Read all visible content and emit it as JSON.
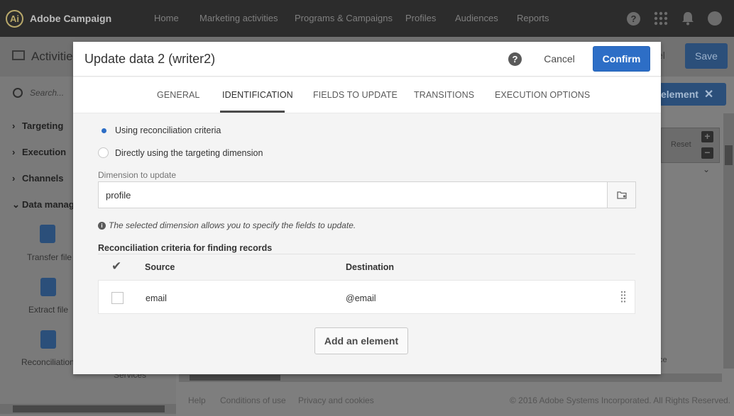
{
  "app": {
    "brand_logo": "Ai",
    "brand_name": "Adobe Campaign",
    "nav": [
      "Home",
      "Marketing activities",
      "Programs & Campaigns",
      "Profiles",
      "Audiences",
      "Reports"
    ],
    "icons": [
      "help-icon",
      "apps-grid-icon",
      "bell-icon",
      "avatar-icon"
    ]
  },
  "background": {
    "page_title": "Activities",
    "search_placeholder": "Search...",
    "categories": [
      "Targeting",
      "Execution",
      "Channels",
      "Data manag..."
    ],
    "tiles": [
      "Transfer file",
      "Extract file",
      "Reconciliation"
    ],
    "services_label": "Services",
    "cancel_fragment": "el",
    "save_label": "Save",
    "add_element_label": "element",
    "reset_label": "Reset",
    "ce_fragment": "ce",
    "footer": {
      "help": "Help",
      "conditions": "Conditions of use",
      "privacy": "Privacy and cookies",
      "copyright": "© 2016 Adobe Systems Incorporated. All Rights Reserved."
    }
  },
  "modal": {
    "title": "Update data 2 (writer2)",
    "help_icon": "?",
    "cancel_label": "Cancel",
    "confirm_label": "Confirm",
    "tabs": [
      {
        "label": "GENERAL",
        "active": false
      },
      {
        "label": "IDENTIFICATION",
        "active": true
      },
      {
        "label": "FIELDS TO UPDATE",
        "active": false
      },
      {
        "label": "TRANSITIONS",
        "active": false
      },
      {
        "label": "EXECUTION OPTIONS",
        "active": false
      }
    ],
    "radio_options": [
      {
        "label": "Using reconciliation criteria",
        "selected": true
      },
      {
        "label": "Directly using the targeting dimension",
        "selected": false
      }
    ],
    "dimension": {
      "label": "Dimension to update",
      "value": "profile"
    },
    "info_text": "The selected dimension allows you to specify the fields to update.",
    "criteria": {
      "title": "Reconciliation criteria for finding records",
      "columns": [
        "Source",
        "Destination"
      ],
      "rows": [
        {
          "source": "email",
          "destination": "@email",
          "checked": false
        }
      ]
    },
    "add_element_label": "Add an element"
  },
  "colors": {
    "topbar": "#2c2c2c",
    "primary": "#2d6ec6",
    "overlay": "#7e7e7e"
  }
}
